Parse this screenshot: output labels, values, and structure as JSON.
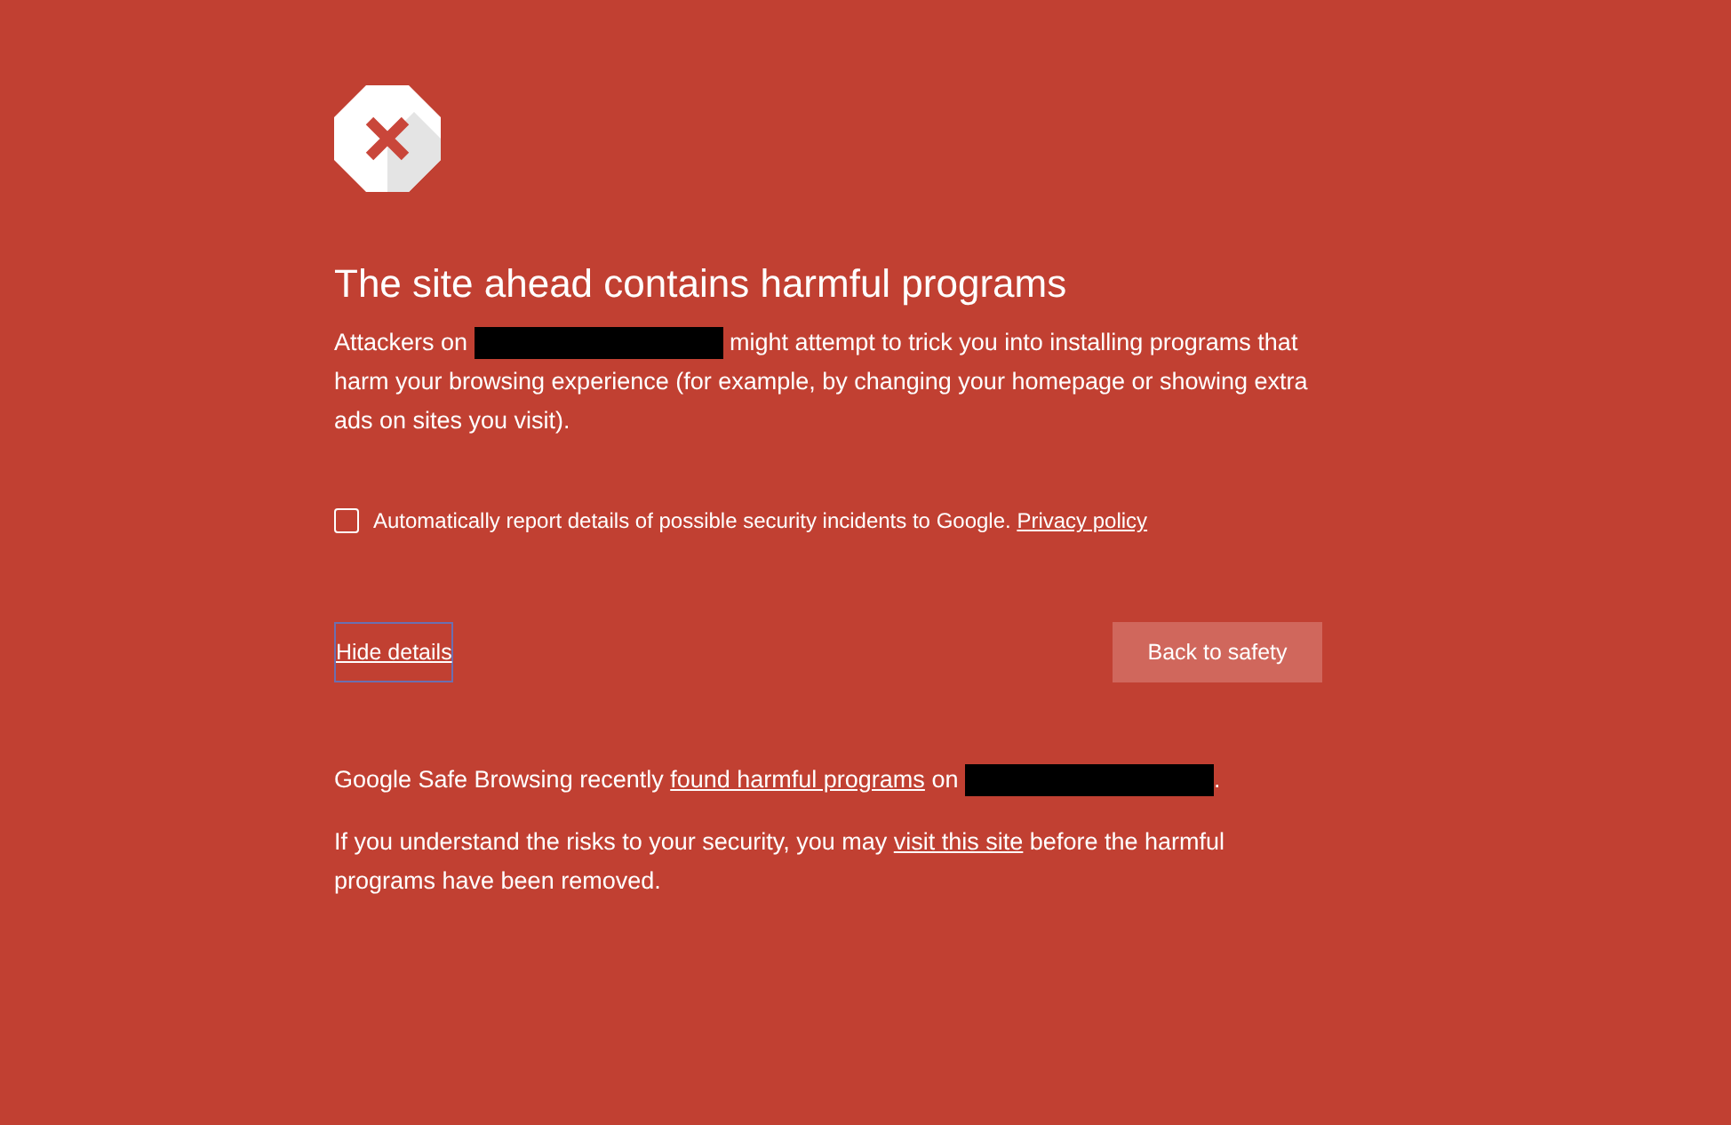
{
  "heading": "The site ahead contains harmful programs",
  "intro": [
    {
      "kind": "text",
      "text": "Attackers on "
    },
    {
      "kind": "redacted"
    },
    {
      "kind": "text",
      "text": " might attempt to trick you into installing programs that harm your browsing experience (for example, by changing your homepage or showing extra ads on sites you visit)."
    }
  ],
  "report": {
    "checked": false,
    "label": "Automatically report details of possible security incidents to Google.",
    "link": "Privacy policy"
  },
  "details_button": {
    "label": "Hide details",
    "focused": true
  },
  "safety_button": "Back to safety",
  "details": [
    [
      {
        "kind": "text",
        "text": "Google Safe Browsing recently "
      },
      {
        "kind": "link",
        "text": "found harmful programs"
      },
      {
        "kind": "text",
        "text": " on "
      },
      {
        "kind": "redacted"
      },
      {
        "kind": "text",
        "text": "."
      }
    ],
    [
      {
        "kind": "text",
        "text": "If you understand the risks to your security, you may "
      },
      {
        "kind": "link",
        "text": "visit this site"
      },
      {
        "kind": "text",
        "text": " before the harmful programs have been removed."
      }
    ]
  ]
}
